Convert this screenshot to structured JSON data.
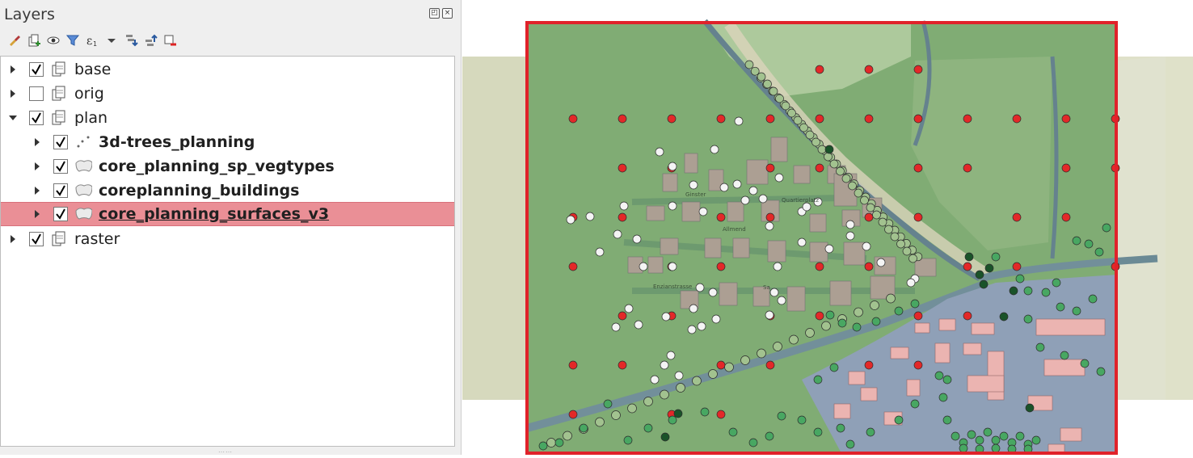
{
  "panel": {
    "title": "Layers",
    "dock_buttons": [
      "float-icon",
      "close-icon"
    ],
    "toolbar": [
      "style-manager-icon",
      "add-group-icon",
      "visibility-icon",
      "filter-legend-icon",
      "filter-expression-icon",
      "dropdown-icon",
      "expand-all-icon",
      "collapse-all-icon",
      "remove-layer-icon"
    ]
  },
  "layers": [
    {
      "name": "base",
      "type": "group",
      "checked": true,
      "expanded": false,
      "level": 0,
      "bold": false,
      "selected": false
    },
    {
      "name": "orig",
      "type": "group",
      "checked": false,
      "expanded": false,
      "level": 0,
      "bold": false,
      "selected": false
    },
    {
      "name": "plan",
      "type": "group",
      "checked": true,
      "expanded": true,
      "level": 0,
      "bold": false,
      "selected": false
    },
    {
      "name": "3d-trees_planning",
      "type": "points",
      "checked": true,
      "expanded": false,
      "level": 1,
      "bold": true,
      "selected": false
    },
    {
      "name": "core_planning_sp_vegtypes",
      "type": "polygon",
      "checked": true,
      "expanded": false,
      "level": 1,
      "bold": true,
      "selected": false
    },
    {
      "name": "coreplanning_buildings",
      "type": "polygon",
      "checked": true,
      "expanded": false,
      "level": 1,
      "bold": true,
      "selected": false
    },
    {
      "name": "core_planning_surfaces_v3",
      "type": "polygon",
      "checked": true,
      "expanded": false,
      "level": 1,
      "bold": true,
      "selected": true
    },
    {
      "name": "raster",
      "type": "group",
      "checked": true,
      "expanded": false,
      "level": 0,
      "bold": false,
      "selected": false
    }
  ],
  "map": {
    "street_labels": [
      "Ginster",
      "Quartierplatz",
      "Allmend",
      "Enzianstrasse",
      "Sa"
    ],
    "colors": {
      "selection_frame": "#e0222a",
      "planning_area": "#7aa86d",
      "vegetation": "#9dbf8a",
      "road": "#5d7c88",
      "settlement": "#8a9bb4",
      "building": "#b09a8c",
      "red_tree": "#e21d1d",
      "white_tree": "#f4f4f4",
      "green_tree": "#3fa35a",
      "dark_tree": "#0e4a1e",
      "hillshade": "#d9dcc0"
    }
  }
}
